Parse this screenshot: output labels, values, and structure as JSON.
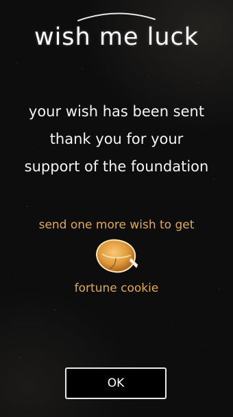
{
  "app": {
    "logo_text": "Wish me luck"
  },
  "message": {
    "lines": [
      "Your wish has been sent",
      "Thank you for your",
      "support of the foundation"
    ]
  },
  "promo": {
    "text": "send one more wish to get",
    "reward_label": "fortune cookie",
    "reward_icon": "fortune-cookie-icon"
  },
  "actions": {
    "ok_label": "OK"
  },
  "colors": {
    "background": "#0d0d0e",
    "text_primary": "#f4f4f0",
    "accent": "#e3a85a"
  }
}
